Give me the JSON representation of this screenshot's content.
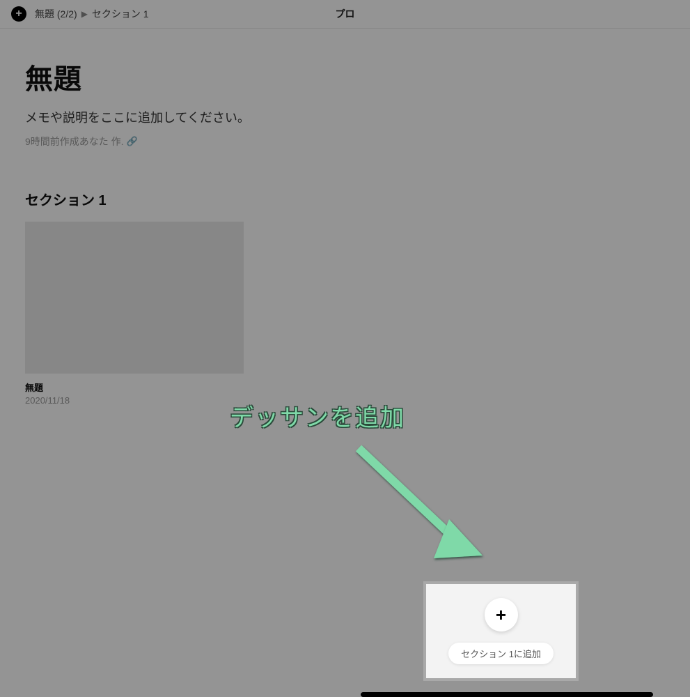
{
  "topbar": {
    "breadcrumb": {
      "item1": "無題 (2/2)",
      "item2": "セクション 1"
    },
    "center": "プロ"
  },
  "page": {
    "title": "無題",
    "description_placeholder": "メモや説明をここに追加してください。",
    "meta_text": "9時間前作成あなた 作."
  },
  "section": {
    "heading": "セクション 1"
  },
  "card": {
    "title": "無題",
    "date": "2020/11/18"
  },
  "add_panel": {
    "button_label": "セクション 1に追加"
  },
  "annotation": {
    "text": "デッサンを追加"
  }
}
